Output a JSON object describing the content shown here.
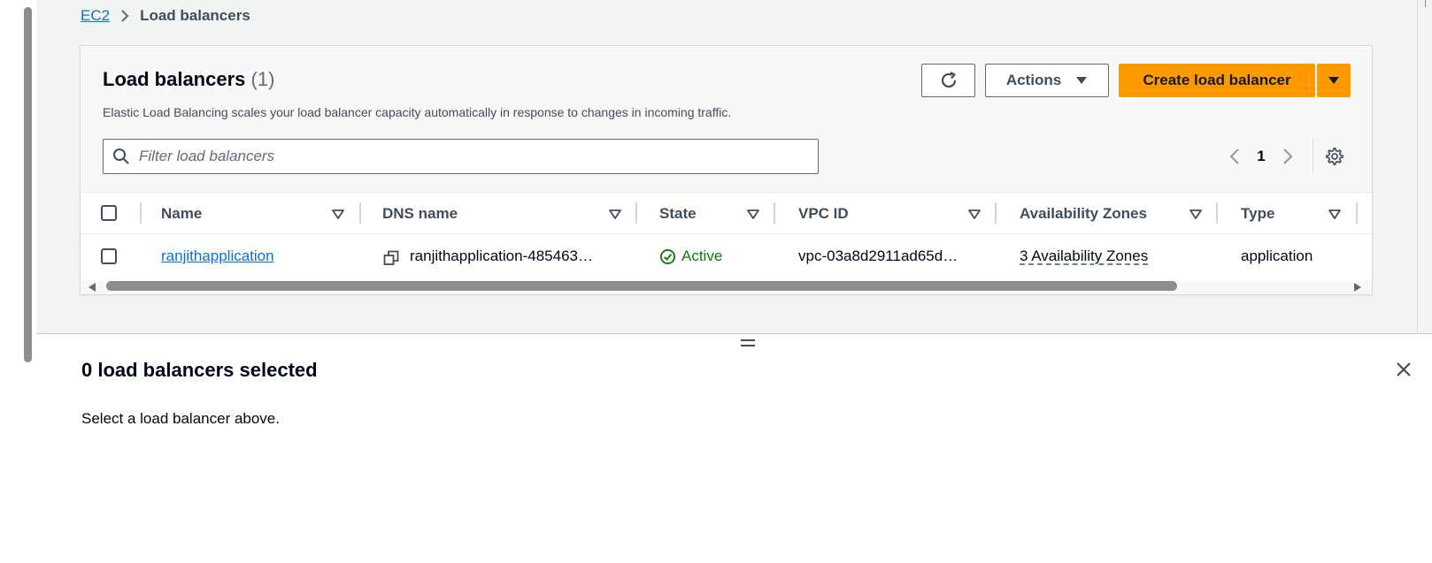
{
  "breadcrumb": {
    "root": "EC2",
    "current": "Load balancers"
  },
  "panel": {
    "title": "Load balancers",
    "count": "(1)",
    "description": "Elastic Load Balancing scales your load balancer capacity automatically in response to changes in incoming traffic."
  },
  "toolbar": {
    "actions_label": "Actions",
    "create_label": "Create load balancer"
  },
  "search": {
    "placeholder": "Filter load balancers"
  },
  "pagination": {
    "current_page": "1"
  },
  "table": {
    "columns": [
      "Name",
      "DNS name",
      "State",
      "VPC ID",
      "Availability Zones",
      "Type"
    ],
    "rows": [
      {
        "name": "ranjithapplication",
        "dns_name": "ranjithapplication-485463…",
        "state": "Active",
        "vpc_id": "vpc-03a8d2911ad65d…",
        "availability_zones": "3 Availability Zones",
        "type": "application"
      }
    ]
  },
  "split_panel": {
    "title": "0 load balancers selected",
    "message": "Select a load balancer above."
  },
  "colors": {
    "primary_button": "#ff9900",
    "link": "#0972d3",
    "status_active": "#037f0c",
    "page_background": "#f2f3f3"
  },
  "icons": {
    "refresh": "refresh-icon",
    "caret": "caret-down-icon",
    "search": "search-icon",
    "settings": "gear-icon",
    "copy": "copy-icon",
    "status": "status-check-icon",
    "close": "close-icon"
  }
}
